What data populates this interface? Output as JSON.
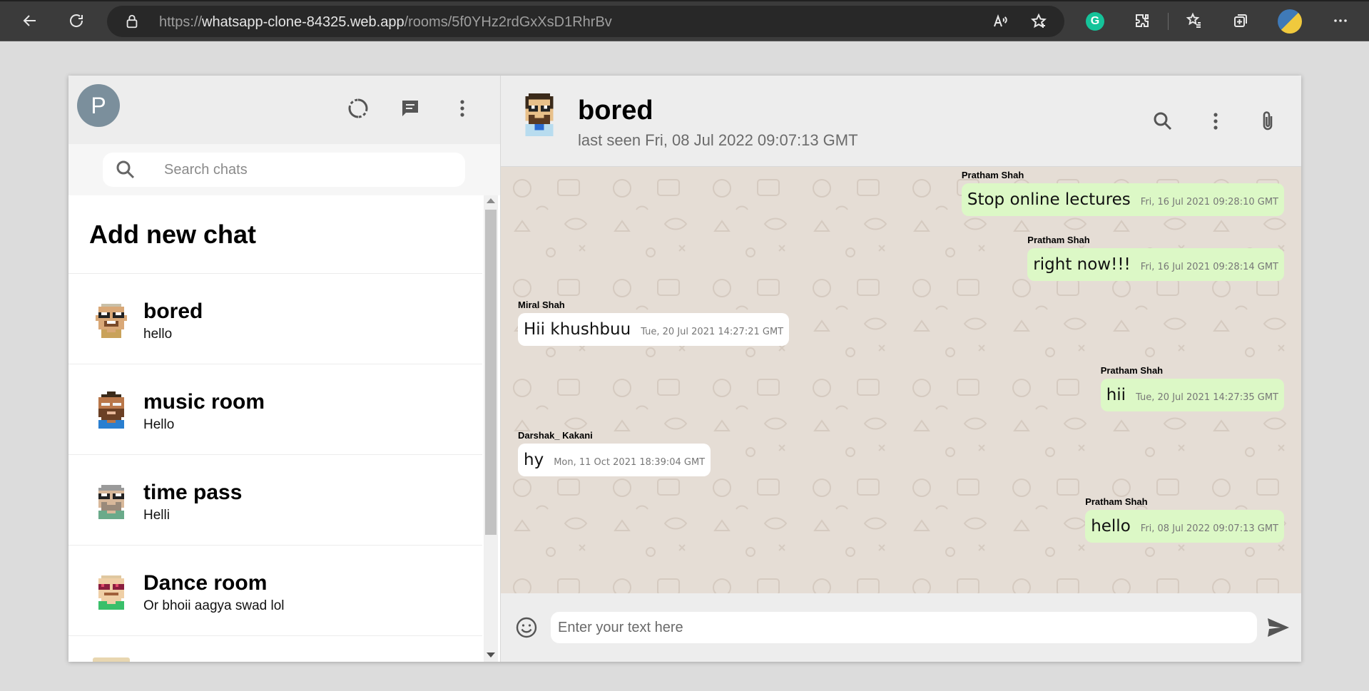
{
  "browser": {
    "url_scheme": "https://",
    "url_host": "whatsapp-clone-84325.web.app",
    "url_path": "/rooms/5f0YHz2rdGxXsD1RhrBv",
    "extension_letter": "G"
  },
  "sidebar": {
    "user_initial": "P",
    "search_placeholder": "Search chats",
    "add_new_chat_label": "Add new chat",
    "chats": [
      {
        "name": "bored",
        "last_message": "hello"
      },
      {
        "name": "music room",
        "last_message": "Hello"
      },
      {
        "name": "time pass",
        "last_message": "Helli"
      },
      {
        "name": "Dance room",
        "last_message": "Or bhoii aagya swad lol"
      }
    ]
  },
  "chat": {
    "title": "bored",
    "status": "last seen Fri, 08 Jul 2022 09:07:13 GMT",
    "messages": [
      {
        "sender": "Pratham Shah",
        "text": "Stop online lectures",
        "time": "Fri, 16 Jul 2021 09:28:10 GMT",
        "type": "sent"
      },
      {
        "sender": "Pratham Shah",
        "text": "right now!!!",
        "time": "Fri, 16 Jul 2021 09:28:14 GMT",
        "type": "sent"
      },
      {
        "sender": "Miral Shah",
        "text": "Hii khushbuu",
        "time": "Tue, 20 Jul 2021 14:27:21 GMT",
        "type": "received"
      },
      {
        "sender": "Pratham Shah",
        "text": "hii",
        "time": "Tue, 20 Jul 2021 14:27:35 GMT",
        "type": "sent"
      },
      {
        "sender": "Darshak_ Kakani",
        "text": "hy",
        "time": "Mon, 11 Oct 2021 18:39:04 GMT",
        "type": "received"
      },
      {
        "sender": "Pratham Shah",
        "text": "hello",
        "time": "Fri, 08 Jul 2022 09:07:13 GMT",
        "type": "sent"
      }
    ],
    "input_placeholder": "Enter your text here"
  },
  "colors": {
    "sent_bubble": "#dcf8c6",
    "received_bubble": "#ffffff",
    "header_bg": "#ededed",
    "chat_bg": "#e5ddd5",
    "avatar_bg": "#7b8f9c"
  },
  "icons": {
    "browser": [
      "back-icon",
      "refresh-icon",
      "lock-icon",
      "read-aloud-icon",
      "add-favorite-icon",
      "grammarly-icon",
      "extensions-icon",
      "favorites-icon",
      "collections-icon",
      "profile-icon",
      "more-icon"
    ],
    "sidebar": [
      "status-icon",
      "new-chat-icon",
      "menu-dots-icon",
      "search-icon"
    ],
    "chat": [
      "search-icon",
      "menu-dots-icon",
      "attach-icon",
      "emoji-icon",
      "send-icon"
    ]
  }
}
